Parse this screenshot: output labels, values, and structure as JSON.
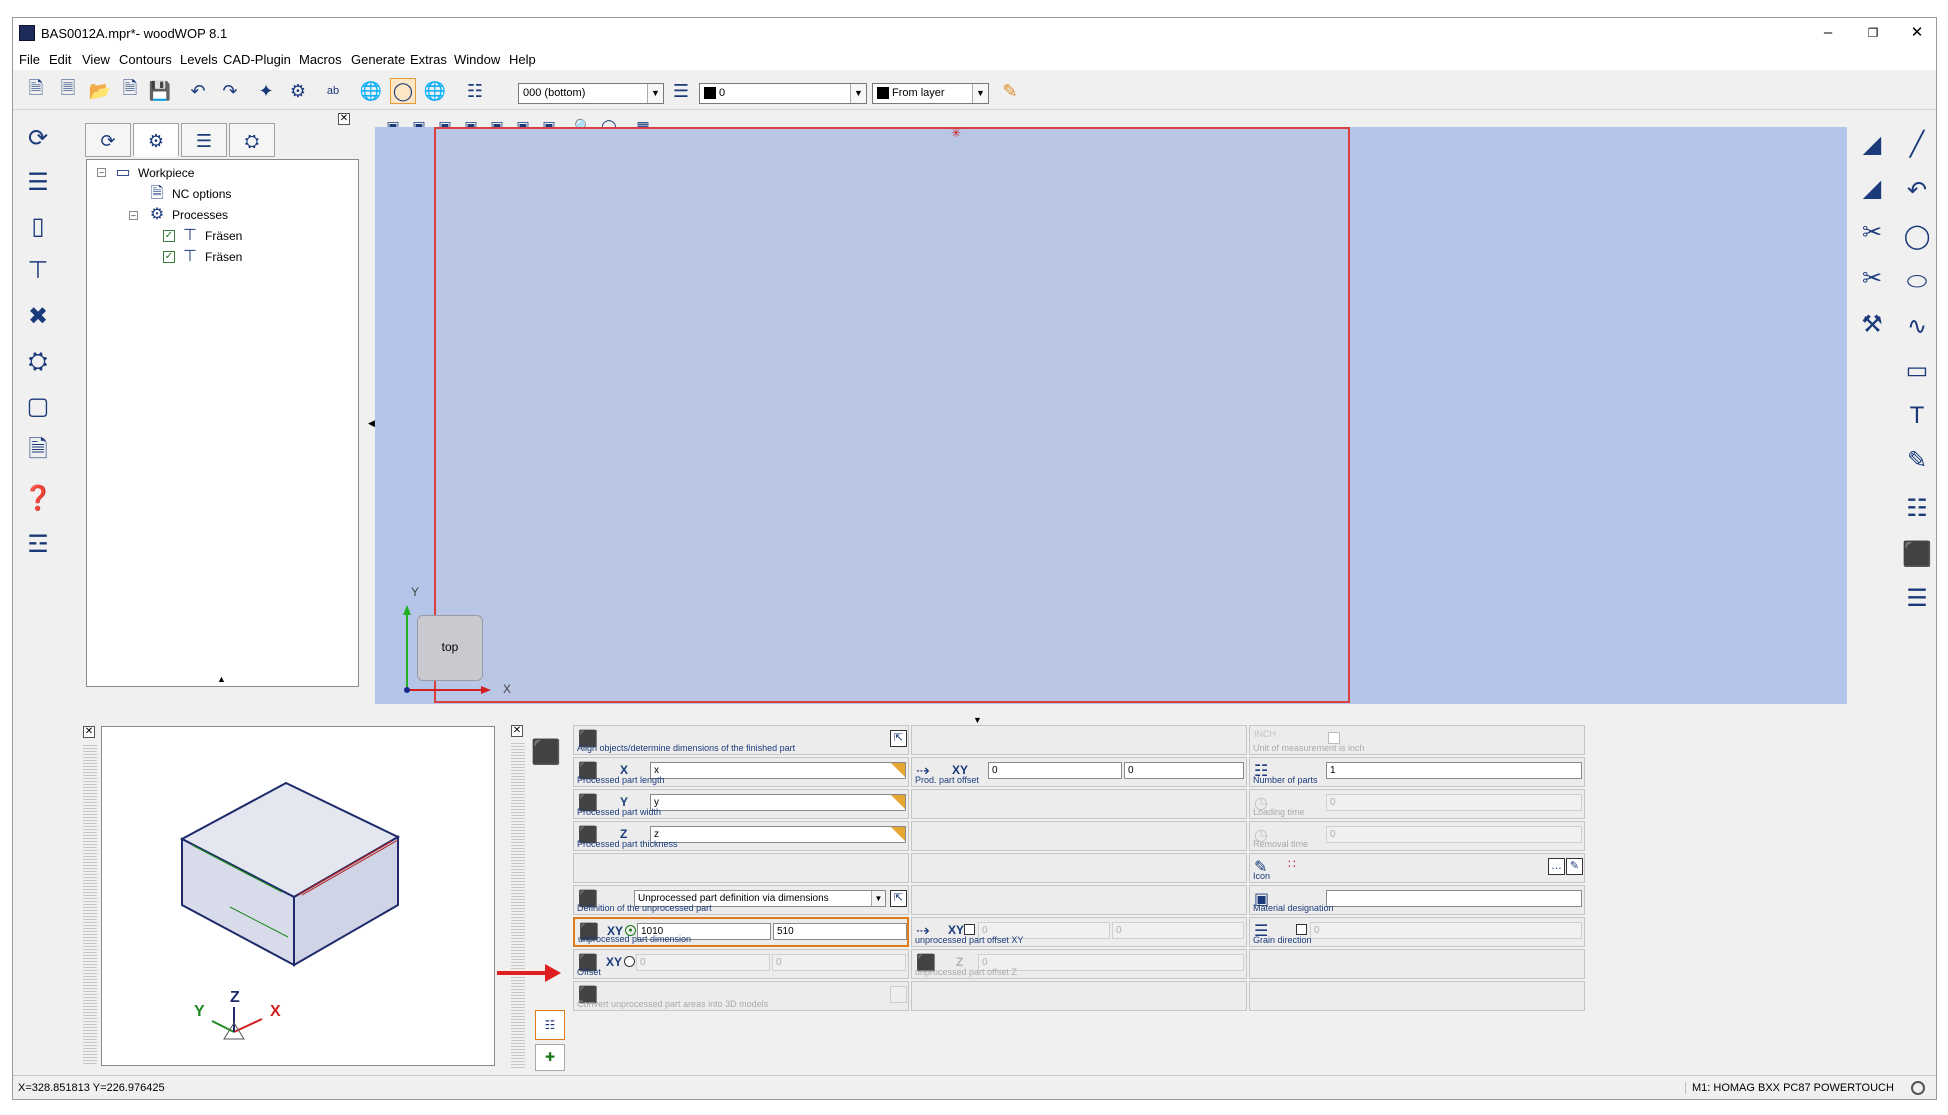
{
  "window": {
    "title": "BAS0012A.mpr*- woodWOP 8.1",
    "minimize": "–",
    "maximize": "❐",
    "close": "✕"
  },
  "menu": [
    "File",
    "Edit",
    "View",
    "Contours",
    "Levels",
    "CAD-Plugin",
    "Macros",
    "Generate",
    "Extras",
    "Window",
    "Help"
  ],
  "toolbar": {
    "level_combo": "000  (bottom)",
    "color_combo": "0",
    "linetype_combo": "From layer"
  },
  "tree": {
    "root": "Workpiece",
    "nc_options": "NC options",
    "processes": "Processes",
    "items": [
      "Fräsen",
      "Fräsen"
    ]
  },
  "viewport": {
    "navcube_label": "top",
    "axis_x": "X",
    "axis_y": "Y"
  },
  "preview": {
    "axis_x": "X",
    "axis_y": "Y",
    "axis_z": "Z"
  },
  "props": {
    "align_label": "Align objects/determine dimensions of the finished part",
    "unit_label": "Unit of measurement is inch",
    "unit_tag": "INCH",
    "length_tag": "X",
    "length_value": "x",
    "length_label": "Processed part length",
    "offset_tag": "XY",
    "offset_x": "0",
    "offset_y": "0",
    "offset_label": "Prod. part offset",
    "parts_value": "1",
    "parts_label": "Number of parts",
    "width_tag": "Y",
    "width_value": "y",
    "width_label": "Processed part width",
    "loading_value": "0",
    "loading_label": "Loading time",
    "thickness_tag": "Z",
    "thickness_value": "z",
    "thickness_label": "Processed part thickness",
    "removal_value": "0",
    "removal_label": "Removal time",
    "icon_label": "Icon",
    "definition_value": "Unprocessed part definition via dimensions",
    "definition_label": "Definition of the unprocessed part",
    "material_label": "Material designation",
    "material_value": "",
    "dim_tag": "XY",
    "dim_x": "1010",
    "dim_y": "510",
    "dim_label": "unprocessed part dimension",
    "dim_offset_tag": "XY",
    "dim_offset_x": "0",
    "dim_offset_y": "0",
    "dim_offset_label": "unprocessed part offset XY",
    "grain_value": "0",
    "grain_label": "Grain direction",
    "offset2_tag": "XY",
    "offset2_x": "0",
    "offset2_y": "0",
    "offset2_label": "Offset",
    "offset_z_tag": "Z",
    "offset_z_value": "0",
    "offset_z_label": "unprocessed part offset Z",
    "convert_label": "Convert unprocessed part areas into 3D models"
  },
  "status": {
    "coords": "X=328.851813 Y=226.976425",
    "machine": "M1: HOMAG BXX PC87 POWERTOUCH"
  },
  "colors": {
    "viewport_bg": "#b5c5e9",
    "workpiece_border": "#d94040",
    "highlight": "#e07a1c",
    "annotation_arrow": "#e02020"
  }
}
